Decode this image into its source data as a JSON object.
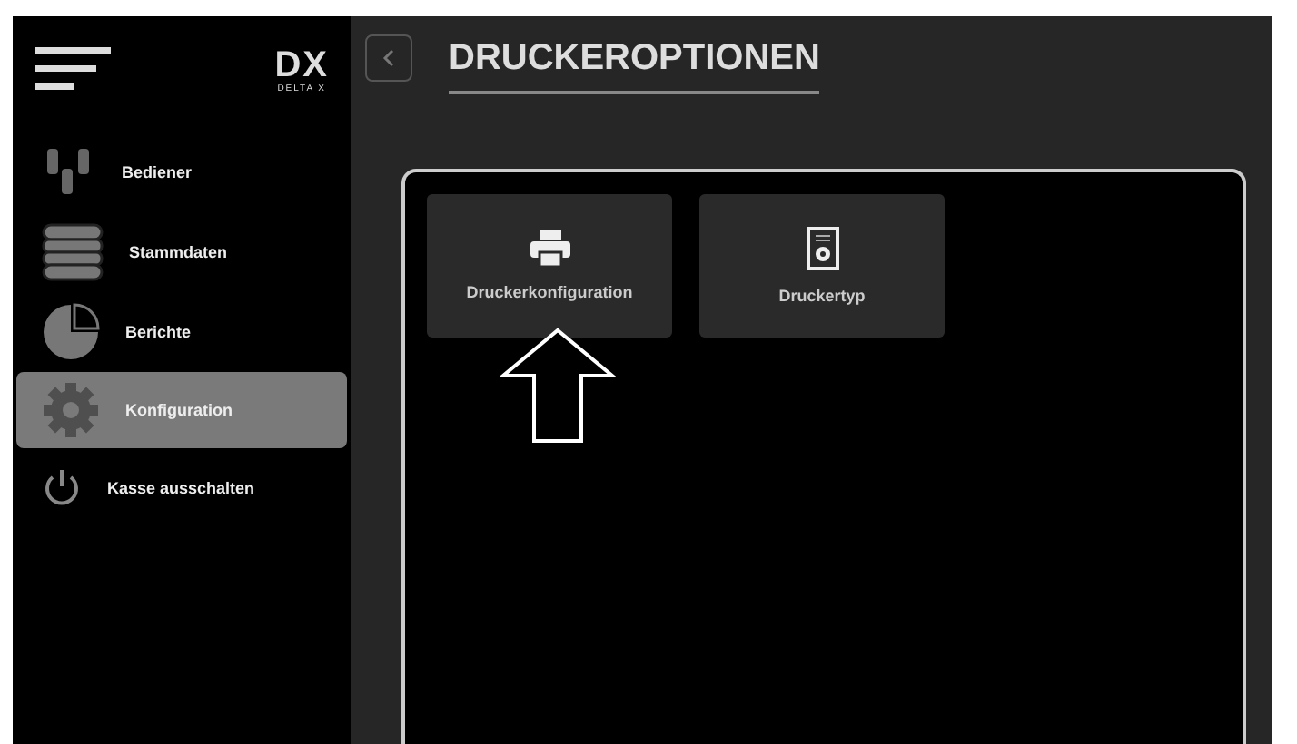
{
  "logo": {
    "mark": "DX",
    "name": "DELTA X"
  },
  "sidebar": {
    "items": [
      {
        "label": "Bediener",
        "kind": "users",
        "selected": false
      },
      {
        "label": "Stammdaten",
        "kind": "database",
        "selected": false
      },
      {
        "label": "Berichte",
        "kind": "pie",
        "selected": false
      },
      {
        "label": "Konfiguration",
        "kind": "gear",
        "selected": true
      },
      {
        "label": "Kasse ausschalten",
        "kind": "power",
        "selected": false
      }
    ]
  },
  "header": {
    "title": "DRUCKEROPTIONEN"
  },
  "tiles": [
    {
      "label": "Druckerkonfiguration",
      "kind": "printer"
    },
    {
      "label": "Druckertyp",
      "kind": "doc"
    }
  ]
}
